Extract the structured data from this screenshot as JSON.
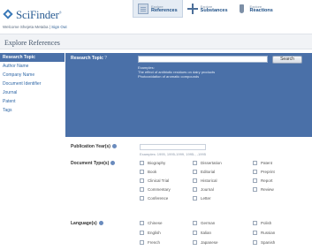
{
  "header": {
    "logo_text": "SciFinder",
    "logo_mark": "®",
    "tabs": [
      {
        "small": "Explore",
        "label": "References",
        "icon": "document-icon"
      },
      {
        "small": "Explore",
        "label": "Substances",
        "icon": "molecule-icon"
      },
      {
        "small": "Explore",
        "label": "Reactions",
        "icon": "flask-icon"
      }
    ]
  },
  "welcome": {
    "prefix": "Welcome Shejeta Metaba",
    "separator": " | ",
    "signout": "Sign Out"
  },
  "page_title": "Explore References",
  "sidebar": {
    "items": [
      {
        "label": "Research Topic",
        "active": true
      },
      {
        "label": "Author Name"
      },
      {
        "label": "Company Name"
      },
      {
        "label": "Document Identifier"
      },
      {
        "label": "Journal"
      },
      {
        "label": "Patent"
      },
      {
        "label": "Tags"
      }
    ]
  },
  "research_topic": {
    "label": "Research Topic",
    "help": "?",
    "value": "",
    "search_label": "Search",
    "examples_heading": "Examples:",
    "example_1": "The effect of antibiotic residues on dairy products",
    "example_2": "Photooxidation of aromatic compounds"
  },
  "publication_years": {
    "label": "Publication Year(s)",
    "example": "Examples: 1995, 1995-1999, 1995-, -1995"
  },
  "document_types": {
    "label": "Document Type(s)",
    "options": [
      "Biography",
      "Dissertation",
      "Patent",
      "Book",
      "Editorial",
      "Preprint",
      "Clinical Trial",
      "Historical",
      "Report",
      "Commentary",
      "Journal",
      "Review",
      "Conference",
      "Letter"
    ]
  },
  "languages": {
    "label": "Language(s)",
    "options": [
      "Chinese",
      "German",
      "Polish",
      "English",
      "Italian",
      "Russian",
      "French",
      "Japanese",
      "Spanish"
    ]
  },
  "colors": {
    "accent": "#4a70a8",
    "link": "#2f67a6"
  }
}
